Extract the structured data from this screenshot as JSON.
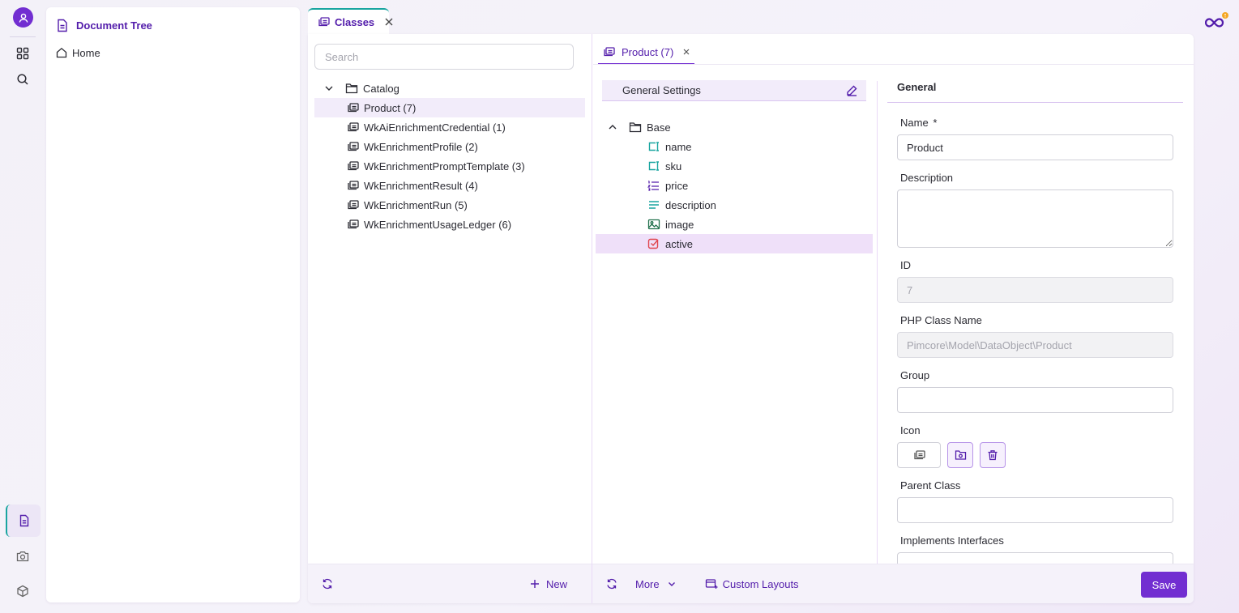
{
  "sidebar": {
    "items": [
      "user-icon",
      "grid-icon",
      "search-icon",
      "document-icon",
      "camera-icon",
      "cube-icon"
    ]
  },
  "document_tree": {
    "title": "Document Tree",
    "home_label": "Home"
  },
  "tabs": {
    "classes_label": "Classes"
  },
  "class_list": {
    "search_placeholder": "Search",
    "folder": "Catalog",
    "items": [
      "Product (7)",
      "WkAiEnrichmentCredential (1)",
      "WkEnrichmentProfile (2)",
      "WkEnrichmentPromptTemplate (3)",
      "WkEnrichmentResult (4)",
      "WkEnrichmentRun (5)",
      "WkEnrichmentUsageLedger (6)"
    ],
    "selected_index": 0,
    "new_label": "New"
  },
  "editor": {
    "tab_label": "Product (7)",
    "general_settings_label": "General Settings",
    "base_label": "Base",
    "fields": [
      {
        "label": "name",
        "icon": "input-icon"
      },
      {
        "label": "sku",
        "icon": "input-icon"
      },
      {
        "label": "price",
        "icon": "numeric-list-icon"
      },
      {
        "label": "description",
        "icon": "textarea-icon"
      },
      {
        "label": "image",
        "icon": "image-icon"
      },
      {
        "label": "active",
        "icon": "checkbox-icon"
      }
    ],
    "selected_field": "active",
    "more_label": "More",
    "custom_layouts_label": "Custom Layouts",
    "save_label": "Save"
  },
  "form": {
    "heading": "General",
    "name_label": "Name",
    "name_required_mark": "*",
    "name_value": "Product",
    "description_label": "Description",
    "description_value": "",
    "id_label": "ID",
    "id_value": "7",
    "php_class_label": "PHP Class Name",
    "php_class_value": "Pimcore\\Model\\DataObject\\Product",
    "group_label": "Group",
    "group_value": "",
    "icon_label": "Icon",
    "parent_class_label": "Parent Class",
    "parent_class_value": "",
    "implements_label": "Implements Interfaces"
  },
  "colors": {
    "accent": "#722ed1",
    "accent_dark": "#531dab",
    "teal": "#19a5a0",
    "selected_bg": "#f2ecfa"
  }
}
